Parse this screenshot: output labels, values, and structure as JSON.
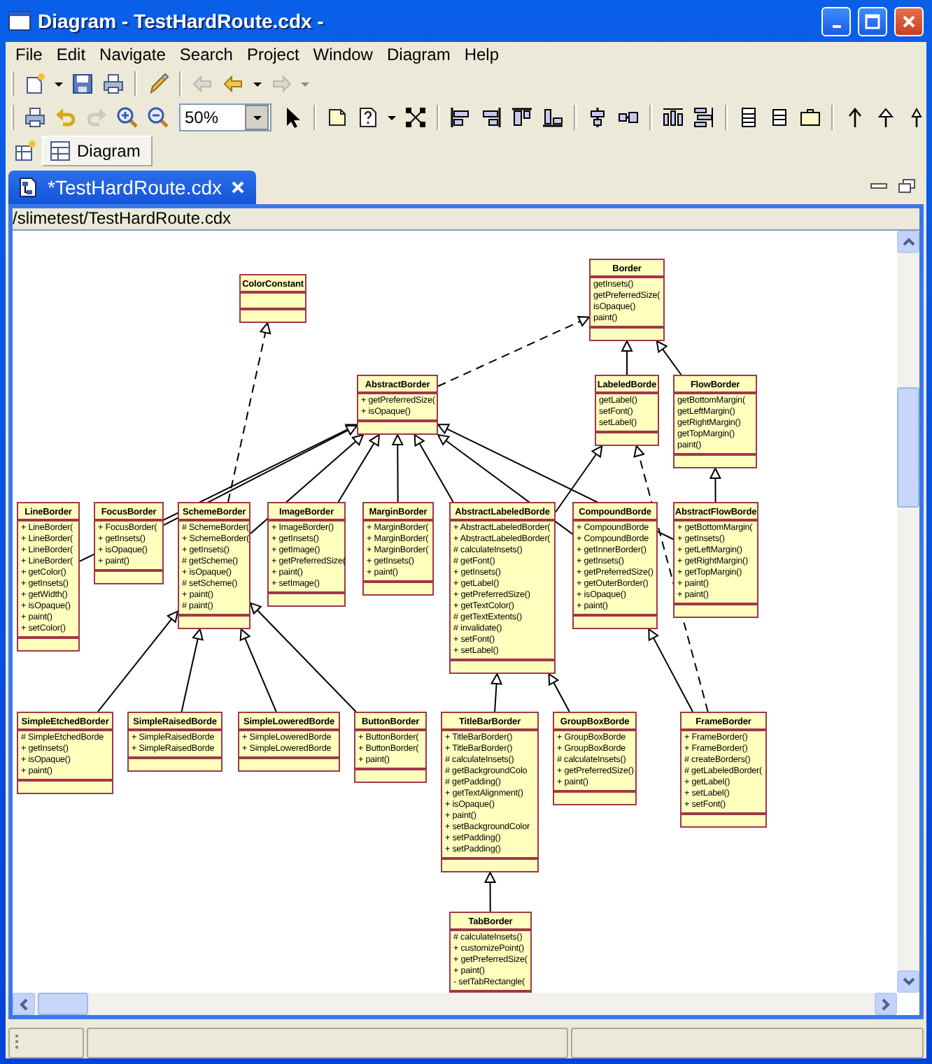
{
  "window": {
    "title": "Diagram - TestHardRoute.cdx -"
  },
  "menu": [
    "File",
    "Edit",
    "Navigate",
    "Search",
    "Project",
    "Window",
    "Diagram",
    "Help"
  ],
  "toolbars": [
    {
      "items": [
        {
          "kind": "button",
          "disabled": false,
          "dropdown": true
        },
        {
          "kind": "button",
          "disabled": false
        },
        {
          "kind": "button",
          "disabled": false
        },
        {
          "kind": "separator"
        },
        {
          "kind": "button",
          "disabled": false
        },
        {
          "kind": "separator"
        },
        {
          "kind": "button",
          "disabled": true
        },
        {
          "kind": "button",
          "disabled": false,
          "dropdown": true
        },
        {
          "kind": "button",
          "disabled": true,
          "dropdown": true
        }
      ]
    },
    {
      "items": [
        {
          "kind": "button",
          "disabled": false
        },
        {
          "kind": "button",
          "disabled": false
        },
        {
          "kind": "button",
          "disabled": true
        },
        {
          "kind": "button",
          "disabled": false
        },
        {
          "kind": "button",
          "disabled": false
        },
        {
          "kind": "combo",
          "value": "50%"
        },
        {
          "kind": "button",
          "disabled": false
        },
        {
          "kind": "separator"
        },
        {
          "kind": "button",
          "disabled": false
        },
        {
          "kind": "button",
          "disabled": false,
          "dropdown": true
        },
        {
          "kind": "button",
          "disabled": false
        },
        {
          "kind": "separator"
        },
        {
          "kind": "button",
          "disabled": false
        },
        {
          "kind": "button",
          "disabled": false
        },
        {
          "kind": "button",
          "disabled": false
        },
        {
          "kind": "button",
          "disabled": false
        },
        {
          "kind": "separator"
        },
        {
          "kind": "button",
          "disabled": false
        },
        {
          "kind": "button",
          "disabled": false
        },
        {
          "kind": "separator"
        },
        {
          "kind": "button",
          "disabled": false
        },
        {
          "kind": "button",
          "disabled": false
        },
        {
          "kind": "separator"
        },
        {
          "kind": "button",
          "disabled": false
        },
        {
          "kind": "button",
          "disabled": false
        },
        {
          "kind": "button",
          "disabled": false
        },
        {
          "kind": "separator"
        },
        {
          "kind": "button",
          "disabled": false
        },
        {
          "kind": "button",
          "disabled": false
        },
        {
          "kind": "button",
          "disabled": false
        }
      ]
    }
  ],
  "view_tab": {
    "label": "Diagram",
    "selected": true
  },
  "editor_tab": {
    "label": "*TestHardRoute.cdx",
    "selected": true
  },
  "path": "/slimetest/TestHardRoute.cdx",
  "classes": [
    {
      "name": "ColorConstant"
    },
    {
      "name": "Border",
      "methods": [
        "getInsets()",
        "getPreferredSize(",
        "isOpaque()",
        "paint()"
      ]
    },
    {
      "name": "AbstractBorder",
      "methods": [
        "+ getPreferredSize(",
        "+ isOpaque()"
      ]
    },
    {
      "name": "LabeledBorde",
      "methods": [
        "getLabel()",
        "setFont()",
        "setLabel()"
      ]
    },
    {
      "name": "FlowBorder",
      "methods": [
        "getBottomMargin(",
        "getLeftMargin()",
        "getRightMargin()",
        "getTopMargin()",
        "paint()"
      ]
    },
    {
      "name": "LineBorder",
      "methods": [
        "+ LineBorder(",
        "+ LineBorder(",
        "+ LineBorder(",
        "+ LineBorder(",
        "+ getColor()",
        "+ getInsets()",
        "+ getWidth()",
        "+ isOpaque()",
        "+ paint()",
        "+ setColor()"
      ]
    },
    {
      "name": "FocusBorder",
      "methods": [
        "+ FocusBorder(",
        "+ getInsets()",
        "+ isOpaque()",
        "+ paint()"
      ]
    },
    {
      "name": "SchemeBorder",
      "methods": [
        "# SchemeBorder(",
        "+ SchemeBorder(",
        "+ getInsets()",
        "# getScheme()",
        "+ isOpaque()",
        "# setScheme()",
        "+ paint()",
        "# paint()"
      ]
    },
    {
      "name": "ImageBorder",
      "methods": [
        "+ ImageBorder()",
        "+ getInsets()",
        "+ getImage()",
        "+ getPreferredSize(",
        "+ paint()",
        "+ setImage()"
      ]
    },
    {
      "name": "MarginBorder",
      "methods": [
        "+ MarginBorder(",
        "+ MarginBorder(",
        "+ MarginBorder(",
        "+ getInsets()",
        "+ paint()"
      ]
    },
    {
      "name": "AbstractLabeledBorde",
      "methods": [
        "+ AbstractLabeledBorder(",
        "+ AbstractLabeledBorder(",
        "# calculateInsets()",
        "# getFont()",
        "+ getInsets()",
        "+ getLabel()",
        "+ getPreferredSize()",
        "+ getTextColor()",
        "# getTextExtents()",
        "# invalidate()",
        "+ setFont()",
        "+ setLabel()"
      ]
    },
    {
      "name": "CompoundBorde",
      "methods": [
        "+ CompoundBorde",
        "+ CompoundBorde",
        "+ getInnerBorder()",
        "+ getInsets()",
        "+ getPreferredSize()",
        "+ getOuterBorder()",
        "+ isOpaque()",
        "+ paint()"
      ]
    },
    {
      "name": "AbstractFlowBorde",
      "methods": [
        "+ getBottomMargin(",
        "+ getInsets()",
        "+ getLeftMargin()",
        "+ getRightMargin()",
        "+ getTopMargin()",
        "+ paint()",
        "+ paint()"
      ]
    },
    {
      "name": "SimpleEtchedBorder",
      "methods": [
        "# SimpleEtchedBorde",
        "+ getInsets()",
        "+ isOpaque()",
        "+ paint()"
      ]
    },
    {
      "name": "SimpleRaisedBorde",
      "methods": [
        "+ SimpleRaisedBorde",
        "+ SimpleRaisedBorde"
      ]
    },
    {
      "name": "SimpleLoweredBorde",
      "methods": [
        "+ SimpleLoweredBorde",
        "+ SimpleLoweredBorde"
      ]
    },
    {
      "name": "ButtonBorder",
      "methods": [
        "+ ButtonBorder(",
        "+ ButtonBorder(",
        "+ paint()"
      ]
    },
    {
      "name": "TitleBarBorder",
      "methods": [
        "+ TitleBarBorder()",
        "+ TitleBarBorder()",
        "# calculateInsets()",
        "# getBackgroundColo",
        "# getPadding()",
        "+ getTextAlignment()",
        "+ isOpaque()",
        "+ paint()",
        "+ setBackgroundColor",
        "+ setPadding()",
        "+ setPadding()"
      ]
    },
    {
      "name": "GroupBoxBorde",
      "methods": [
        "+ GroupBoxBorde",
        "+ GroupBoxBorde",
        "# calculateInsets()",
        "+ getPreferredSize()",
        "+ paint()"
      ]
    },
    {
      "name": "FrameBorder",
      "methods": [
        "+ FrameBorder()",
        "+ FrameBorder()",
        "# createBorders()",
        "# getLabeledBorder(",
        "+ getLabel()",
        "+ setLabel()",
        "+ setFont()"
      ]
    },
    {
      "name": "TabBorder",
      "methods": [
        "# calculateInsets()",
        "+ customizePoint()",
        "+ getPreferredSize(",
        "+ paint()",
        "- setTabRectangle("
      ]
    }
  ]
}
